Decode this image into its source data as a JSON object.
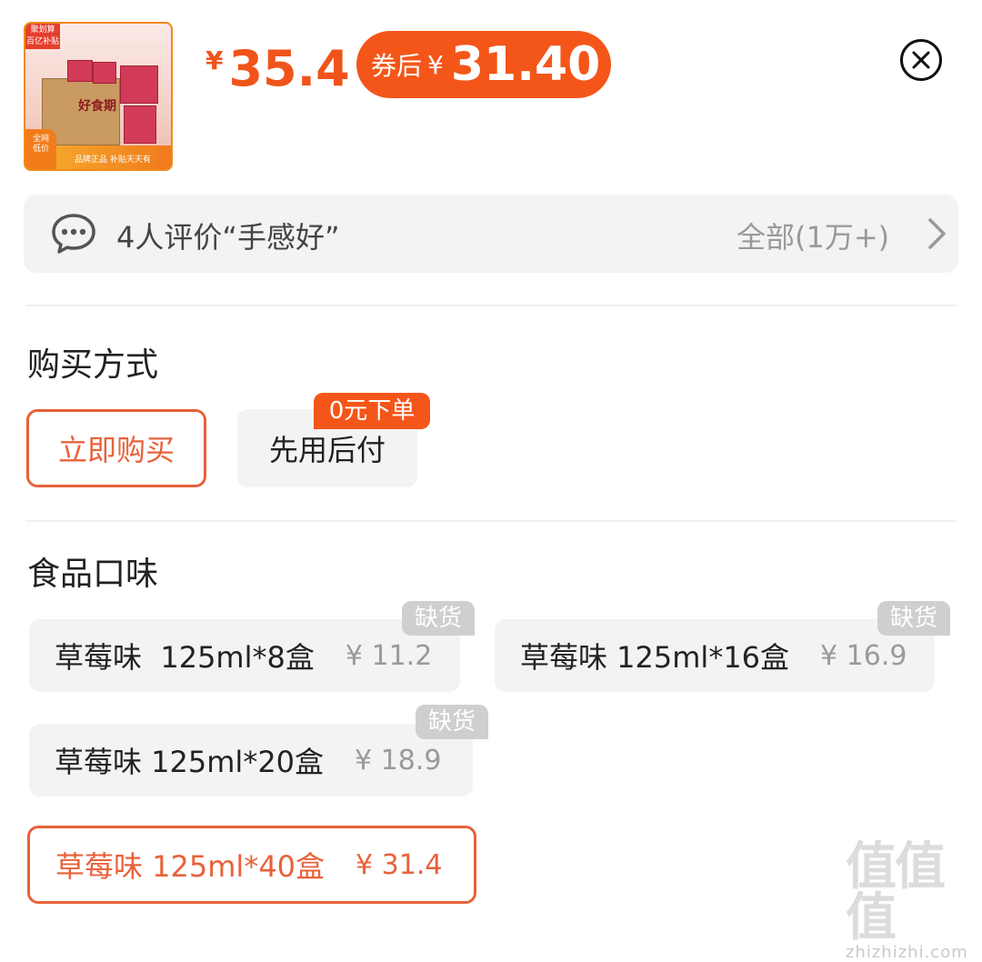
{
  "product": {
    "thumb_badge": "聚划算\n百亿补贴",
    "thumb_brand_text": "好食期",
    "thumb_corner": "全网\n低价",
    "thumb_bottom": "品牌正品  补贴天天有",
    "price_symbol": "¥",
    "price": "35.4",
    "coupon_label": "券后",
    "coupon_symbol": "¥",
    "coupon_price": "31.40"
  },
  "close": {
    "icon": "close-circle-icon"
  },
  "review": {
    "icon": "chat-bubble-icon",
    "text": "4人评价“手感好”",
    "all_label": "全部(1万+)",
    "chevron": "chevron-right-icon"
  },
  "purchase": {
    "title": "购买方式",
    "options": [
      {
        "label": "立即购买",
        "selected": true
      },
      {
        "label": "先用后付",
        "selected": false,
        "tag": "0元下单"
      }
    ]
  },
  "flavor": {
    "title": "食品口味",
    "options": [
      {
        "name": "草莓味  125ml*8盒",
        "price": "¥ 11.2",
        "out_of_stock": true,
        "tag": "缺货"
      },
      {
        "name": "草莓味 125ml*16盒",
        "price": "¥ 16.9",
        "out_of_stock": true,
        "tag": "缺货"
      },
      {
        "name": "草莓味 125ml*20盒",
        "price": "¥ 18.9",
        "out_of_stock": true,
        "tag": "缺货"
      },
      {
        "name": "草莓味 125ml*40盒",
        "price": "¥ 31.4",
        "out_of_stock": false,
        "selected": true
      }
    ]
  },
  "watermark": {
    "text": "值值值",
    "sub": "zhizhizhi.com"
  },
  "colors": {
    "accent": "#f4561a",
    "selected_border": "#e8623b",
    "muted": "#9a9a9a"
  }
}
